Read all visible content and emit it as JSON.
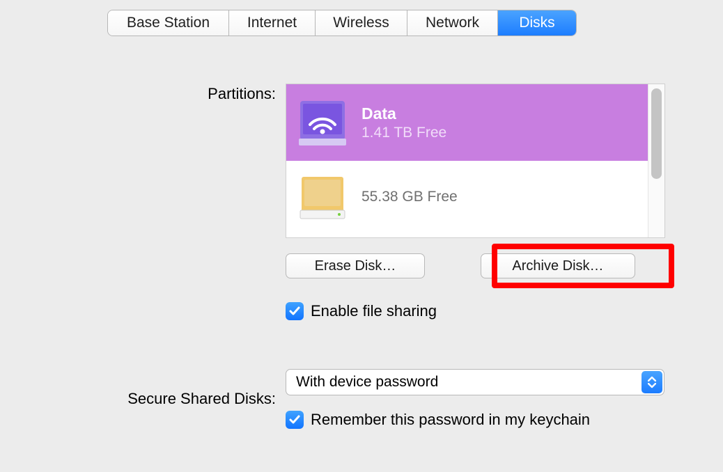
{
  "tabs": {
    "t0": "Base Station",
    "t1": "Internet",
    "t2": "Wireless",
    "t3": "Network",
    "t4": "Disks",
    "active_index": 4
  },
  "labels": {
    "partitions": "Partitions:",
    "secure_shared": "Secure Shared Disks:"
  },
  "partitions": {
    "p0": {
      "name": "Data",
      "free": "1.41 TB Free"
    },
    "p1": {
      "name": "",
      "free": "55.38 GB Free"
    }
  },
  "buttons": {
    "erase": "Erase Disk…",
    "archive": "Archive Disk…"
  },
  "checkboxes": {
    "file_sharing": "Enable file sharing",
    "remember_keychain": "Remember this password in my keychain"
  },
  "secure_shared_select": {
    "value": "With device password"
  }
}
